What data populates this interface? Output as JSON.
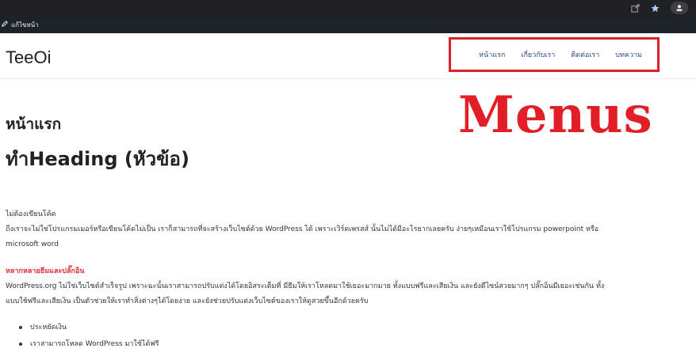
{
  "browser": {
    "icons": [
      "share-icon",
      "star-icon",
      "profile-icon"
    ]
  },
  "admin_bar": {
    "edit_label": "แก้ไขหน้า"
  },
  "site": {
    "title": "TeeOi"
  },
  "nav": {
    "items": [
      {
        "label": "หน้าแรก"
      },
      {
        "label": "เกี่ยวกับเรา"
      },
      {
        "label": "ติดต่อเรา"
      },
      {
        "label": "บทความ"
      }
    ],
    "highlight_color": "#d9222a"
  },
  "annotation": {
    "text": "Menus",
    "color": "#e21f26"
  },
  "main": {
    "page_title": "หน้าแรก",
    "heading": "ทำHeading (หัวข้อ)",
    "section1": {
      "title": "ไม่ต้องเขียนโค้ด",
      "line1": "ถึงเราจะไม่ใช่โปรแกรมเมอร์หรือเขียนโค้ดไม่เป็น เราก็สามารถที่จะสร้างเว็บไซต์ด้วย WordPress ได้ เพราะเวิร์ดเพรสส์ นั้นไม่ได้มีอะไรยากเลยครับ ง่ายๆเหมือนเราใช้โปรแกรม powerpoint หรือ",
      "line2": "microsoft word"
    },
    "section2": {
      "title": "หลากหลายธีมและปลั๊กอิน",
      "line1": "WordPress.org ไม่ใช่เว็บไซต์สำเร็จรูป เพราะฉะนั้นเราสามารถปรับแต่งได้โดยอิสระเต็มที่ มีธีมให้เราโหลดมาใช้เยอะมากมาย ทั้งแบบฟรีและเสียเงิน และยังดีไซน์สวยมากๆ ปลั๊กอินมีเยอะเช่นกัน ทั้ง",
      "line2": "แบบใช้ฟรีและเสียเงิน เป็นตัวช่วยให้เราทำสิ่งต่างๆได้โดยง่าย และยังช่วยปรับแต่งเว็บไซต์ของเราให้ดูสวยขึ้นอีกด้วยครับ"
    },
    "bullets": [
      {
        "text": "ประหยัดเงิน"
      },
      {
        "text": "เราสามารถโหลด WordPress มาใช้ได้ฟรี"
      }
    ]
  }
}
